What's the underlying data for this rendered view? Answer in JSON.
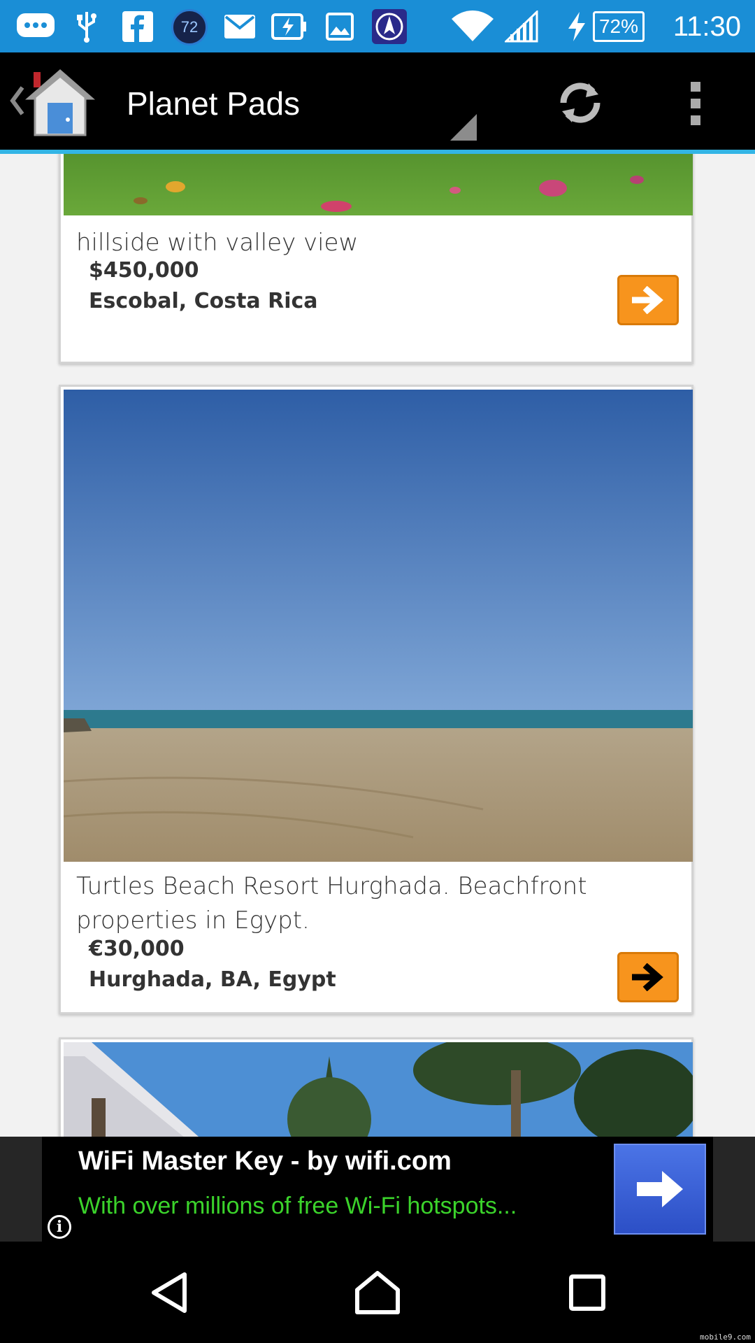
{
  "status_bar": {
    "notification_badge": "72",
    "battery": "72%",
    "time": "11:30",
    "icons": [
      "chat-icon",
      "usb-icon",
      "facebook-icon",
      "badge-72-icon",
      "mail-icon",
      "battery-saver-icon",
      "image-icon",
      "nav-app-icon",
      "wifi-icon",
      "signal-icon",
      "charging-icon"
    ]
  },
  "action_bar": {
    "title": "Planet Pads",
    "icons": [
      "back-chevron-icon",
      "home-app-icon",
      "refresh-icon",
      "overflow-menu-icon"
    ]
  },
  "listings": [
    {
      "title": "hillside with valley view",
      "price": "$450,000",
      "location": "Escobal, Costa Rica"
    },
    {
      "title": "Turtles Beach Resort Hurghada. Beachfront properties in Egypt.",
      "price": "€30,000",
      "location": "Hurghada, BA, Egypt"
    }
  ],
  "ad": {
    "title": "WiFi Master Key - by wifi.com",
    "subtitle": "With over millions of free Wi-Fi hotspots...",
    "info_glyph": "i"
  },
  "watermark": "mobile9.com",
  "colors": {
    "status_bar": "#1a8ed6",
    "action_bar": "#000000",
    "accent_line": "#33b5e5",
    "go_button": "#f7941d",
    "ad_subtitle": "#3bd32b",
    "ad_button": "#3a62d8"
  }
}
